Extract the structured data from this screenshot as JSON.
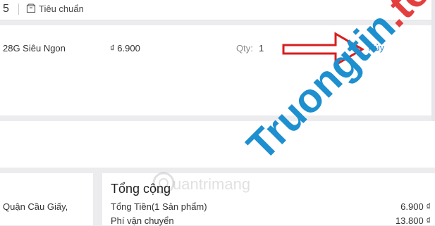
{
  "header": {
    "shop_count": "5",
    "shipping_type": "Tiêu chuẩn"
  },
  "item": {
    "name": "28G Siêu Ngon",
    "price": "₫ 6.900",
    "qty_label": "Qty:",
    "qty_value": "1",
    "cancel_label": "Hủy"
  },
  "address": {
    "text": "Quận Cầu Giấy,"
  },
  "summary": {
    "title": "Tổng cộng",
    "subtotal_label": "Tổng Tiền(1 Sản phẩm)",
    "subtotal_value": "6.900 ₫",
    "shipping_label": "Phí vận chuyển",
    "shipping_value": "13.800 ₫"
  },
  "watermark": {
    "logo_text": "uantrimang",
    "main_blue": "Truongtin",
    "main_dot": ".",
    "main_red": "top"
  },
  "colors": {
    "link": "#3b8fd8",
    "annotation_arrow": "#d81e1e",
    "watermark_blue": "#1e8fcf",
    "watermark_red": "#e43f3f"
  }
}
